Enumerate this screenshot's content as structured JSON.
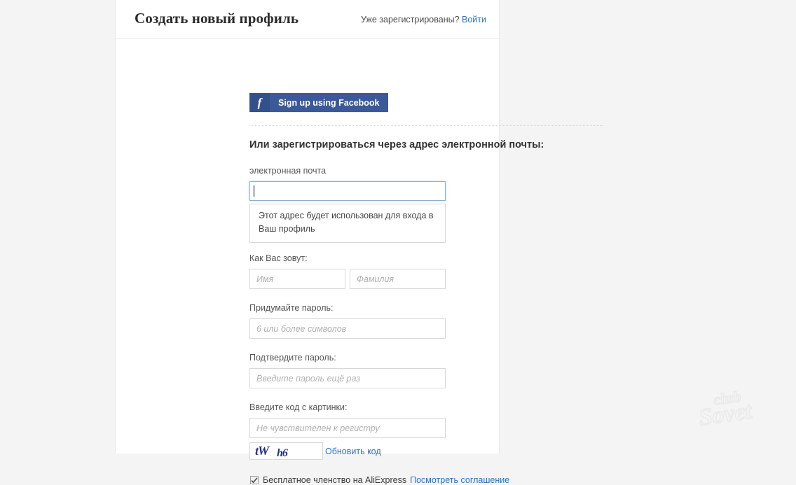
{
  "page": {
    "title": "Создать новый профиль",
    "background_color": "#f4f4f4",
    "panel_color": "#ffffff"
  },
  "header": {
    "title": "Создать новый профиль",
    "already_registered_text": "Уже зарегистрированы?",
    "login_link": "Войти",
    "link_color": "#2a72c4"
  },
  "social": {
    "facebook_button_label": "Sign up using Facebook",
    "facebook_icon_glyph": "f",
    "facebook_color": "#3b5998",
    "facebook_icon_color": "#33508a"
  },
  "form": {
    "email_section_heading": "Или зарегистрироваться через адрес электронной почты:",
    "email_label": "электронная почта",
    "email_value": "",
    "email_placeholder": "",
    "email_hint": "Этот адрес будет использован для входа в Ваш профиль",
    "email_focus_border_color": "#8ab0d0",
    "name_label": "Как Вас зовут:",
    "first_name_placeholder": "Имя",
    "first_name_value": "",
    "last_name_placeholder": "Фамилия",
    "last_name_value": "",
    "password_label": "Придумайте пароль:",
    "password_placeholder": "6 или более символов",
    "password_value": "",
    "password_confirm_label": "Подтвердите пароль:",
    "password_confirm_placeholder": "Введите пароль ещё раз",
    "password_confirm_value": "",
    "captcha_label": "Введите код с картинки:",
    "captcha_placeholder": "Не чувствителен к регистру",
    "captcha_value": "",
    "captcha_image_text_primary": "tW",
    "captcha_image_text_secondary": "h6",
    "captcha_text_color": "#26308c",
    "refresh_captcha_link": "Обновить код"
  },
  "agreement": {
    "checkbox_checked": true,
    "text": "Бесплатное членство на AliExpress",
    "link": "Посмотреть соглашение"
  },
  "watermark": {
    "line1": "club",
    "line2": "Sovet"
  }
}
